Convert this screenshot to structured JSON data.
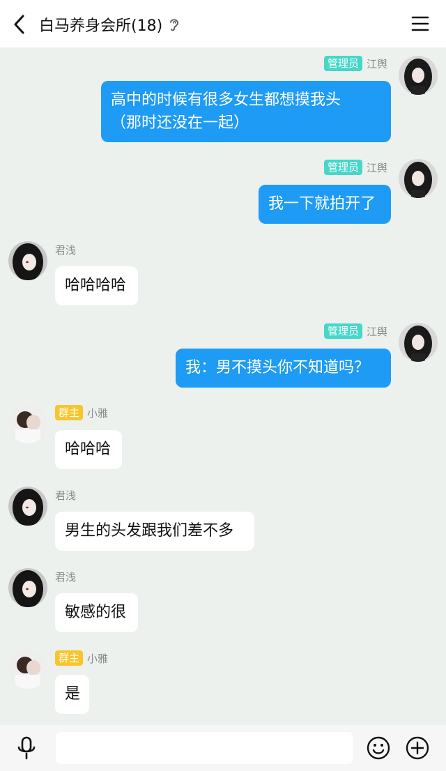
{
  "header": {
    "title": "白马养身会所(18)",
    "back_icon": "chevron-left-icon",
    "ear_icon": "ear-icon",
    "menu_icon": "hamburger-menu-icon"
  },
  "colors": {
    "outgoing_bubble": "#1e9bf5",
    "incoming_bubble": "#ffffff",
    "admin_badge": "#46d7c9",
    "owner_badge": "#f8c52a",
    "chat_background": "#edf1ee"
  },
  "messages": [
    {
      "side": "out",
      "badge": "管理员",
      "sender": "江舆",
      "lines": [
        "高中的时候有很多女生都想摸我头",
        "（那时还没在一起）"
      ]
    },
    {
      "side": "out",
      "badge": "管理员",
      "sender": "江舆",
      "lines": [
        "我一下就拍开了"
      ]
    },
    {
      "side": "in",
      "badge": "",
      "sender": "君浅",
      "lines": [
        "哈哈哈哈"
      ]
    },
    {
      "side": "out",
      "badge": "管理员",
      "sender": "江舆",
      "lines": [
        "我：男不摸头你不知道吗？"
      ]
    },
    {
      "side": "in",
      "badge": "群主",
      "sender": "小雅",
      "lines": [
        "哈哈哈"
      ]
    },
    {
      "side": "in",
      "badge": "",
      "sender": "君浅",
      "lines": [
        "男生的头发跟我们差不多"
      ]
    },
    {
      "side": "in",
      "badge": "",
      "sender": "君浅",
      "lines": [
        "敏感的很"
      ]
    },
    {
      "side": "in",
      "badge": "群主",
      "sender": "小雅",
      "lines": [
        "是"
      ]
    }
  ],
  "input_bar": {
    "mic_icon": "microphone-icon",
    "input_value": "",
    "emoji_icon": "emoji-icon",
    "plus_icon": "plus-circle-icon"
  }
}
